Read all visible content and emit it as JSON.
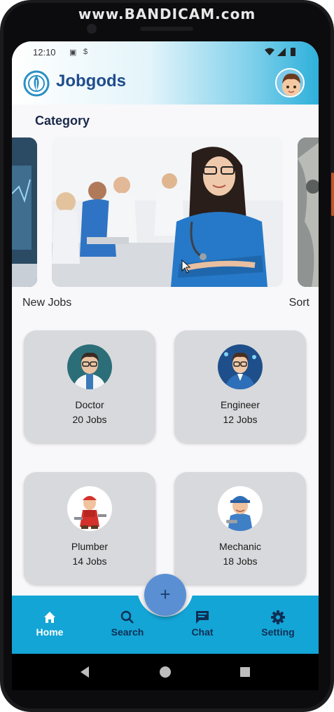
{
  "watermark": "www.BANDICAM.com",
  "status": {
    "time": "12:10"
  },
  "header": {
    "app_title": "Jobgods"
  },
  "category": {
    "title": "Category"
  },
  "jobs_row": {
    "new_jobs": "New Jobs",
    "sort": "Sort"
  },
  "jobs": [
    {
      "name": "Doctor",
      "count": "20 Jobs"
    },
    {
      "name": "Engineer",
      "count": "12 Jobs"
    },
    {
      "name": "Plumber",
      "count": "14 Jobs"
    },
    {
      "name": "Mechanic",
      "count": "18 Jobs"
    }
  ],
  "fab": {
    "label": "+"
  },
  "nav": [
    {
      "label": "Home",
      "icon": "home-icon",
      "active": true
    },
    {
      "label": "Search",
      "icon": "search-icon",
      "active": false
    },
    {
      "label": "Chat",
      "icon": "chat-icon",
      "active": false
    },
    {
      "label": "Setting",
      "icon": "gear-icon",
      "active": false
    }
  ],
  "colors": {
    "nav_bg": "#13a5d6",
    "title": "#1f4d8c",
    "card_bg": "#d8d9dc",
    "fab": "#5a90d3"
  }
}
